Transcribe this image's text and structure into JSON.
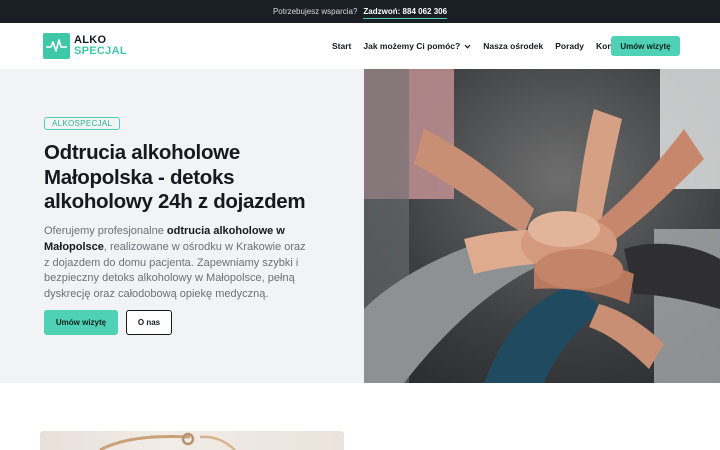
{
  "topbar": {
    "support_text": "Potrzebujesz wsparcia?",
    "call_label": "Zadzwoń:",
    "phone": "884 062 306"
  },
  "logo": {
    "line1": "ALKO",
    "line2": "SPECJAL"
  },
  "nav": {
    "items": [
      {
        "label": "Start"
      },
      {
        "label": "Jak możemy Ci pomóc?",
        "has_dropdown": true
      },
      {
        "label": "Nasza ośrodek"
      },
      {
        "label": "Porady"
      },
      {
        "label": "Kontakt"
      }
    ],
    "cta": "Umów wizytę"
  },
  "hero": {
    "badge": "ALKOSPECJAL",
    "title": "Odtrucia alkoholowe Małopolska - detoks alkoholowy 24h z dojazdem",
    "desc_1": "Oferujemy profesjonalne ",
    "desc_bold": "odtrucia alkoholowe w Małopolsce",
    "desc_2": ", realizowane w ośrodku w Krakowie oraz z dojazdem do domu pacjenta. Zapewniamy szybki i bezpieczny detoks alkoholowy w Małopolsce, pełną dyskrecję oraz całodobową opiekę medyczną.",
    "btn_primary": "Umów wizytę",
    "btn_secondary": "O nas"
  },
  "colors": {
    "accent": "#4fd1b5",
    "dark": "#1a1f26",
    "hero_bg": "#f2f3f5"
  }
}
